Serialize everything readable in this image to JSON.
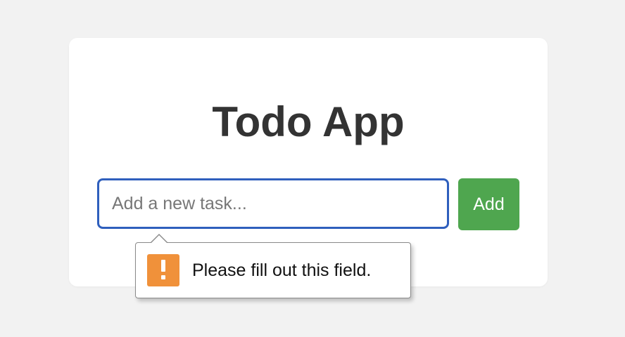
{
  "app": {
    "title": "Todo App"
  },
  "task_form": {
    "input_value": "",
    "input_placeholder": "Add a new task...",
    "add_label": "Add"
  },
  "validation_tooltip": {
    "icon": "warning-icon",
    "message": "Please fill out this field."
  },
  "colors": {
    "background": "#f2f2f2",
    "card": "#ffffff",
    "title": "#333333",
    "input_focus_border": "#2f5fbd",
    "add_button": "#4fa64f",
    "warning": "#f0913a"
  }
}
